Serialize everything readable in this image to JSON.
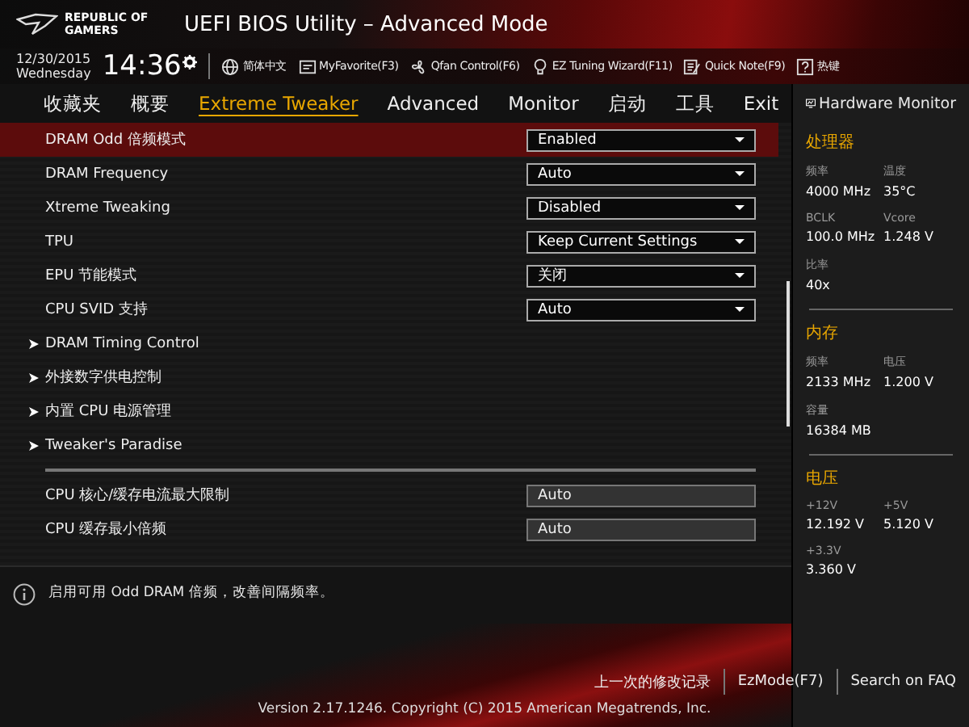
{
  "header": {
    "logo_text": "REPUBLIC OF GAMERS",
    "title": "UEFI BIOS Utility – Advanced Mode"
  },
  "info_bar": {
    "date": "12/30/2015",
    "weekday": "Wednesday",
    "time": "14:36",
    "items": [
      {
        "kind": "globe",
        "label": "简体中文"
      },
      {
        "kind": "favorite",
        "label": "MyFavorite(F3)"
      },
      {
        "kind": "fan",
        "label": "Qfan Control(F6)"
      },
      {
        "kind": "bulb",
        "label": "EZ Tuning Wizard(F11)"
      },
      {
        "kind": "note",
        "label": "Quick Note(F9)"
      },
      {
        "kind": "help",
        "label": "热键"
      }
    ]
  },
  "tabs": [
    {
      "label": "收藏夹",
      "selected": false
    },
    {
      "label": "概要",
      "selected": false
    },
    {
      "label": "Extreme Tweaker",
      "selected": true
    },
    {
      "label": "Advanced",
      "selected": false
    },
    {
      "label": "Monitor",
      "selected": false
    },
    {
      "label": "启动",
      "selected": false
    },
    {
      "label": "工具",
      "selected": false
    },
    {
      "label": "Exit",
      "selected": false
    }
  ],
  "settings": [
    {
      "kind": "select",
      "label": "DRAM Odd 倍频模式",
      "value": "Enabled",
      "selected": true
    },
    {
      "kind": "select",
      "label": "DRAM Frequency",
      "value": "Auto",
      "selected": false
    },
    {
      "kind": "select",
      "label": "Xtreme Tweaking",
      "value": "Disabled",
      "selected": false
    },
    {
      "kind": "select",
      "label": "TPU",
      "value": "Keep Current Settings",
      "selected": false
    },
    {
      "kind": "select",
      "label": "EPU 节能模式",
      "value": "关闭",
      "selected": false
    },
    {
      "kind": "select",
      "label": "CPU SVID 支持",
      "value": "Auto",
      "selected": false
    },
    {
      "kind": "submenu",
      "label": "DRAM Timing Control",
      "selected": false
    },
    {
      "kind": "submenu",
      "label": "外接数字供电控制",
      "selected": false
    },
    {
      "kind": "submenu",
      "label": "内置 CPU 电源管理",
      "selected": false
    },
    {
      "kind": "submenu",
      "label": "Tweaker's Paradise",
      "selected": false
    },
    {
      "kind": "separator"
    },
    {
      "kind": "input",
      "label": "CPU 核心/缓存电流最大限制",
      "value": "Auto",
      "selected": false
    },
    {
      "kind": "input",
      "label": "CPU 缓存最小倍频",
      "value": "Auto",
      "selected": false
    }
  ],
  "help_text": "启用可用 Odd DRAM 倍频，改善间隔频率。",
  "hardware_monitor": {
    "title": "Hardware Monitor",
    "sections": [
      {
        "title": "处理器",
        "fields": [
          {
            "label": "频率",
            "value": "4000 MHz"
          },
          {
            "label": "温度",
            "value": "35°C"
          },
          {
            "label": "BCLK",
            "value": "100.0 MHz"
          },
          {
            "label": "Vcore",
            "value": "1.248 V"
          },
          {
            "label": "比率",
            "value": "40x"
          }
        ]
      },
      {
        "title": "内存",
        "fields": [
          {
            "label": "频率",
            "value": "2133 MHz"
          },
          {
            "label": "电压",
            "value": "1.200 V"
          },
          {
            "label": "容量",
            "value": "16384 MB"
          }
        ]
      },
      {
        "title": "电压",
        "fields": [
          {
            "label": "+12V",
            "value": "12.192 V"
          },
          {
            "label": "+5V",
            "value": "5.120 V"
          },
          {
            "label": "+3.3V",
            "value": "3.360 V"
          }
        ]
      }
    ]
  },
  "footer": {
    "links": [
      "上一次的修改记录",
      "EzMode(F7)",
      "Search on FAQ"
    ],
    "version": "Version 2.17.1246. Copyright (C) 2015 American Megatrends, Inc."
  }
}
